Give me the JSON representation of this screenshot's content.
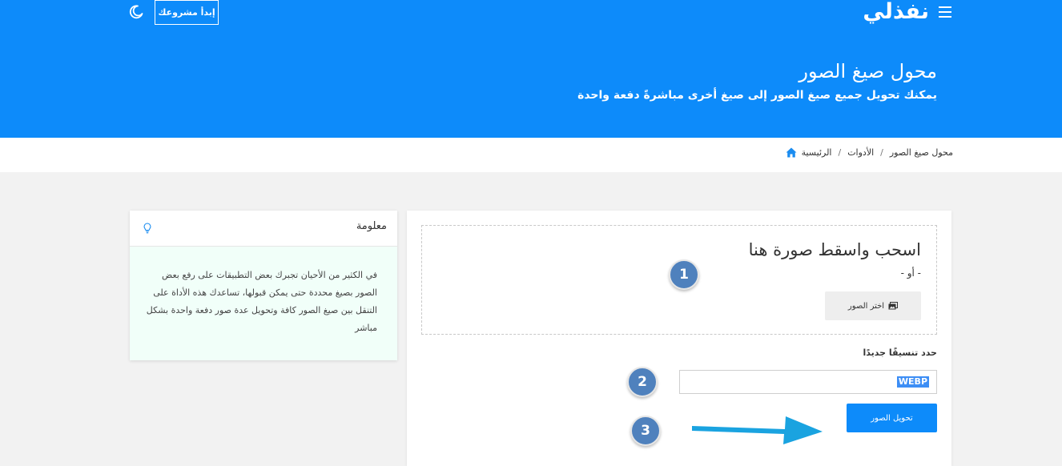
{
  "header": {
    "logo": "نفذلي",
    "start_project": "إبدأ مشروعك",
    "menu_icon": "hamburger-menu-icon",
    "theme_icon": "moon-icon"
  },
  "hero": {
    "title": "محول صيغ الصور",
    "subtitle": "يمكنك تحويل جميع صيغ الصور إلى صيغ أخرى مباشرةً دفعة واحدة"
  },
  "breadcrumb": {
    "home_icon": "home-icon",
    "items": [
      "الرئيسية",
      "الأدوات",
      "محول صيغ الصور"
    ],
    "separator": "/"
  },
  "info": {
    "title": "معلومة",
    "icon": "lightbulb-icon",
    "text": "في الكثير من الأحيان تجبرك بعض التطبيقات على رفع بعض الصور بصيغ محددة حتى يمكن قبولها، تساعدك هذه الأداة على التنقل بين صيغ الصور كافة وتحويل عدة صور دفعة واحدة بشكل مباشر"
  },
  "upload": {
    "drop_title": "اسحب واسقط صورة هنا",
    "or_text": "- أو -",
    "choose_label": "اختر الصور",
    "choose_icon": "images-icon"
  },
  "format": {
    "label": "حدد تنسيقًا جديدًا",
    "value": "WEBP"
  },
  "convert_label": "تحويل الصور",
  "steps": [
    "1",
    "2",
    "3"
  ],
  "colors": {
    "brand": "#0d8bfa",
    "badge": "#4f81bd",
    "info_bg": "#f1fff9",
    "arrow": "#1aa3e0"
  }
}
